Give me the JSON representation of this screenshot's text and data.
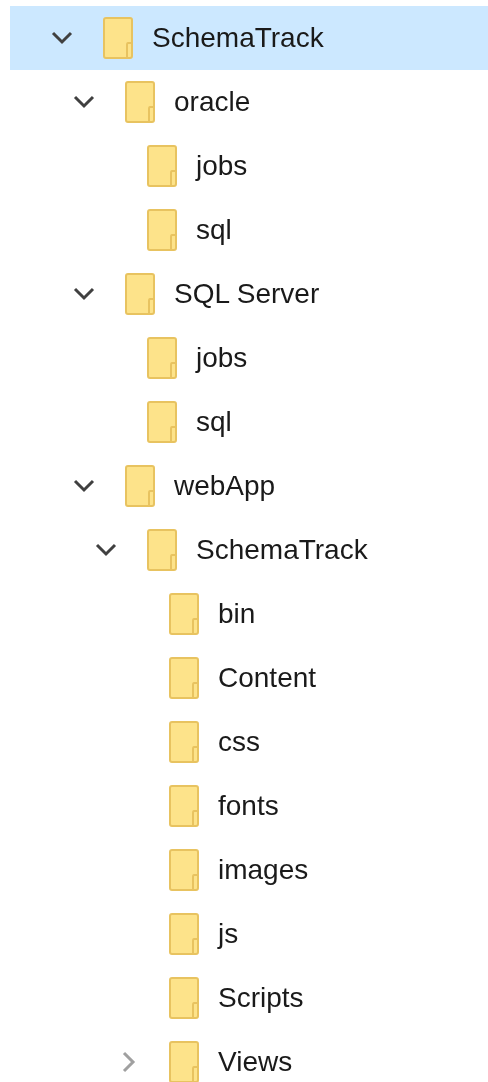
{
  "tree": [
    {
      "label": "SchemaTrack",
      "selected": true,
      "expanded": true,
      "children": [
        {
          "label": "oracle",
          "selected": false,
          "expanded": true,
          "children": [
            {
              "label": "jobs",
              "selected": false
            },
            {
              "label": "sql",
              "selected": false
            }
          ]
        },
        {
          "label": "SQL Server",
          "selected": false,
          "expanded": true,
          "children": [
            {
              "label": "jobs",
              "selected": false
            },
            {
              "label": "sql",
              "selected": false
            }
          ]
        },
        {
          "label": "webApp",
          "selected": false,
          "expanded": true,
          "children": [
            {
              "label": "SchemaTrack",
              "selected": false,
              "expanded": true,
              "children": [
                {
                  "label": "bin",
                  "selected": false
                },
                {
                  "label": "Content",
                  "selected": false
                },
                {
                  "label": "css",
                  "selected": false
                },
                {
                  "label": "fonts",
                  "selected": false
                },
                {
                  "label": "images",
                  "selected": false
                },
                {
                  "label": "js",
                  "selected": false
                },
                {
                  "label": "Scripts",
                  "selected": false
                },
                {
                  "label": "Views",
                  "selected": false,
                  "expanded": false
                }
              ]
            }
          ]
        }
      ]
    }
  ]
}
